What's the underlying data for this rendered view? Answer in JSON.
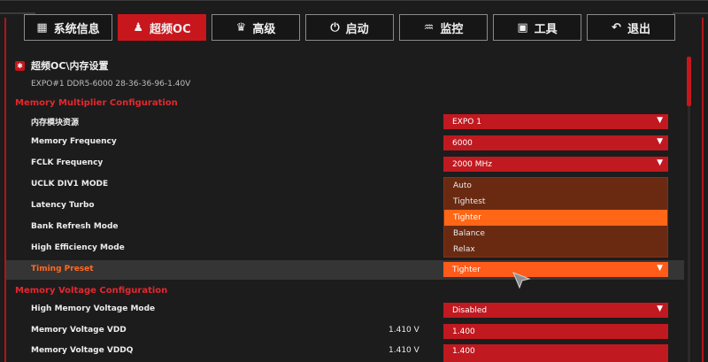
{
  "tabs": [
    {
      "label": "系统信息",
      "icon": "grid-icon",
      "active": false
    },
    {
      "label": "超频OC",
      "icon": "bell-icon",
      "active": true
    },
    {
      "label": "高级",
      "icon": "crown-icon",
      "active": false
    },
    {
      "label": "启动",
      "icon": "power-icon",
      "active": false
    },
    {
      "label": "监控",
      "icon": "pulse-icon",
      "active": false
    },
    {
      "label": "工具",
      "icon": "toolbox-icon",
      "active": false
    },
    {
      "label": "退出",
      "icon": "back-arrow-icon",
      "active": false
    }
  ],
  "page": {
    "breadcrumb": "超频OC\\内存设置",
    "expo_info": "EXPO#1 DDR5-6000 28-36-36-96-1.40V"
  },
  "sections": {
    "multiplier": "Memory Multiplier Configuration",
    "voltage": "Memory Voltage Configuration"
  },
  "settings": {
    "module_source": {
      "label": "内存模块资源",
      "value": "EXPO 1"
    },
    "memory_frequency": {
      "label": "Memory Frequency",
      "value": "6000"
    },
    "fclk_frequency": {
      "label": "FCLK Frequency",
      "value": "2000 MHz"
    },
    "uclk_div1": {
      "label": "UCLK DIV1 MODE"
    },
    "latency_turbo": {
      "label": "Latency Turbo"
    },
    "bank_refresh": {
      "label": "Bank Refresh Mode"
    },
    "high_efficiency": {
      "label": "High Efficiency Mode"
    },
    "timing_preset": {
      "label": "Timing Preset",
      "value": "Tighter"
    },
    "high_mem_voltage": {
      "label": "High Memory Voltage Mode",
      "value": "Disabled"
    },
    "vdd": {
      "label": "Memory Voltage VDD",
      "current": "1.410 V",
      "value": "1.400"
    },
    "vddq": {
      "label": "Memory Voltage VDDQ",
      "current": "1.410 V",
      "value": "1.400"
    }
  },
  "timing_options": [
    "Auto",
    "Tightest",
    "Tighter",
    "Balance",
    "Relax"
  ],
  "timing_selected": "Tighter",
  "colors": {
    "accent": "#c8161d",
    "highlight": "#ff6616",
    "section": "#e3282f"
  }
}
